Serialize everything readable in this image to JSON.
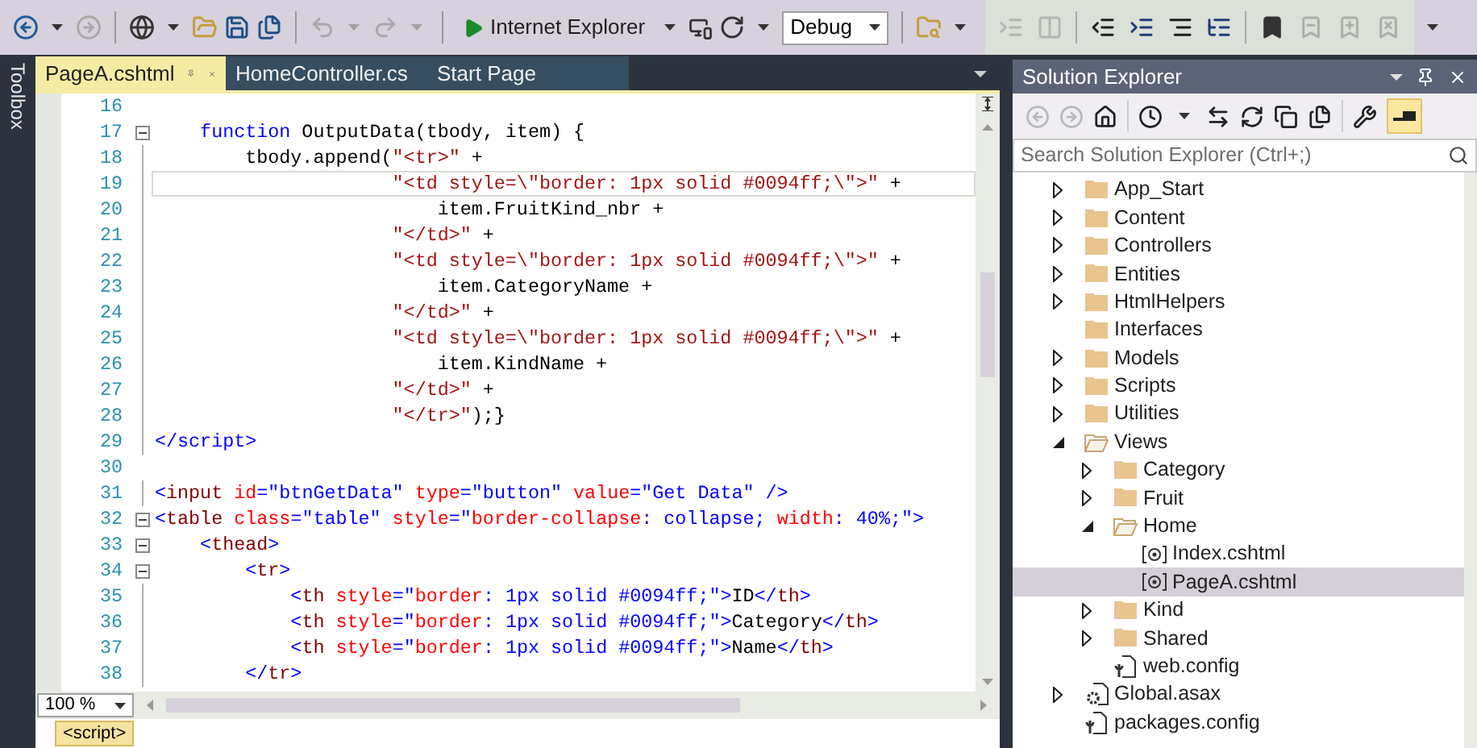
{
  "toolbar": {
    "browser": "Internet Explorer",
    "configuration": "Debug"
  },
  "side_tab": "Toolbox",
  "tabs": [
    {
      "label": "PageA.cshtml",
      "selected": true
    },
    {
      "label": "HomeController.cs",
      "selected": false
    },
    {
      "label": "Start Page",
      "selected": false
    }
  ],
  "code_lines": [
    {
      "number": "16",
      "fold": false,
      "current": false
    },
    {
      "number": "17",
      "fold": true,
      "current": false,
      "tokens": [
        {
          "kind": "keyword",
          "text": "    function"
        },
        {
          "kind": "plain",
          "text": " OutputData(tbody, item) {"
        }
      ]
    },
    {
      "number": "18",
      "fold": false,
      "current": false,
      "tokens": [
        {
          "kind": "plain",
          "text": "        tbody.append("
        },
        {
          "kind": "string",
          "text": "\"<tr>\""
        },
        {
          "kind": "plain",
          "text": " +"
        }
      ]
    },
    {
      "number": "19",
      "fold": false,
      "current": true,
      "tokens": [
        {
          "kind": "string",
          "text": "                     \"<td style=\\\"border: 1px solid #0094ff;\\\">\""
        },
        {
          "kind": "plain",
          "text": " +"
        }
      ]
    },
    {
      "number": "20",
      "fold": false,
      "current": false,
      "tokens": [
        {
          "kind": "plain",
          "text": "                         item.FruitKind_nbr +"
        }
      ]
    },
    {
      "number": "21",
      "fold": false,
      "current": false,
      "tokens": [
        {
          "kind": "string",
          "text": "                     \"</td>\""
        },
        {
          "kind": "plain",
          "text": " +"
        }
      ]
    },
    {
      "number": "22",
      "fold": false,
      "current": false,
      "tokens": [
        {
          "kind": "string",
          "text": "                     \"<td style=\\\"border: 1px solid #0094ff;\\\">\""
        },
        {
          "kind": "plain",
          "text": " +"
        }
      ]
    },
    {
      "number": "23",
      "fold": false,
      "current": false,
      "tokens": [
        {
          "kind": "plain",
          "text": "                         item.CategoryName +"
        }
      ]
    },
    {
      "number": "24",
      "fold": false,
      "current": false,
      "tokens": [
        {
          "kind": "string",
          "text": "                     \"</td>\""
        },
        {
          "kind": "plain",
          "text": " +"
        }
      ]
    },
    {
      "number": "25",
      "fold": false,
      "current": false,
      "tokens": [
        {
          "kind": "string",
          "text": "                     \"<td style=\\\"border: 1px solid #0094ff;\\\">\""
        },
        {
          "kind": "plain",
          "text": " +"
        }
      ]
    },
    {
      "number": "26",
      "fold": false,
      "current": false,
      "tokens": [
        {
          "kind": "plain",
          "text": "                         item.KindName +"
        }
      ]
    },
    {
      "number": "27",
      "fold": false,
      "current": false,
      "tokens": [
        {
          "kind": "string",
          "text": "                     \"</td>\""
        },
        {
          "kind": "plain",
          "text": " +"
        }
      ]
    },
    {
      "number": "28",
      "fold": false,
      "current": false,
      "tokens": [
        {
          "kind": "string",
          "text": "                     \"</tr>\""
        },
        {
          "kind": "plain",
          "text": ");}"
        }
      ]
    },
    {
      "number": "29",
      "fold": false,
      "current": false,
      "tokens": [
        {
          "kind": "delim",
          "text": "</"
        },
        {
          "kind": "delim",
          "text": "script"
        },
        {
          "kind": "delim",
          "text": ">"
        }
      ]
    },
    {
      "number": "30",
      "fold": false,
      "current": false
    },
    {
      "number": "31",
      "fold": false,
      "current": false,
      "tokens": [
        {
          "kind": "delim",
          "text": "<"
        },
        {
          "kind": "element",
          "text": "input"
        },
        {
          "kind": "attr",
          "text": " id"
        },
        {
          "kind": "value",
          "text": "=\"btnGetData\""
        },
        {
          "kind": "attr",
          "text": " type"
        },
        {
          "kind": "value",
          "text": "=\"button\""
        },
        {
          "kind": "attr",
          "text": " value"
        },
        {
          "kind": "value",
          "text": "=\"Get Data\" />"
        }
      ]
    },
    {
      "number": "32",
      "fold": true,
      "current": false,
      "tokens": [
        {
          "kind": "delim",
          "text": "<"
        },
        {
          "kind": "element",
          "text": "table"
        },
        {
          "kind": "attr",
          "text": " class"
        },
        {
          "kind": "value",
          "text": "=\"table\""
        },
        {
          "kind": "attr",
          "text": " style"
        },
        {
          "kind": "value",
          "text": "=\""
        },
        {
          "kind": "attr",
          "text": "border-collapse"
        },
        {
          "kind": "value",
          "text": ": collapse; "
        },
        {
          "kind": "attr",
          "text": "width"
        },
        {
          "kind": "value",
          "text": ": 40%;\">"
        }
      ]
    },
    {
      "number": "33",
      "fold": true,
      "current": false,
      "tokens": [
        {
          "kind": "delim",
          "text": "    <"
        },
        {
          "kind": "element",
          "text": "thead"
        },
        {
          "kind": "delim",
          "text": ">"
        }
      ]
    },
    {
      "number": "34",
      "fold": true,
      "current": false,
      "tokens": [
        {
          "kind": "delim",
          "text": "        <"
        },
        {
          "kind": "element",
          "text": "tr"
        },
        {
          "kind": "delim",
          "text": ">"
        }
      ]
    },
    {
      "number": "35",
      "fold": false,
      "current": false,
      "tokens": [
        {
          "kind": "delim",
          "text": "            <"
        },
        {
          "kind": "element",
          "text": "th"
        },
        {
          "kind": "attr",
          "text": " style"
        },
        {
          "kind": "value",
          "text": "=\""
        },
        {
          "kind": "attr",
          "text": "border"
        },
        {
          "kind": "value",
          "text": ": 1px solid #0094ff;\">"
        },
        {
          "kind": "plain",
          "text": "ID"
        },
        {
          "kind": "delim",
          "text": "</"
        },
        {
          "kind": "element",
          "text": "th"
        },
        {
          "kind": "delim",
          "text": ">"
        }
      ]
    },
    {
      "number": "36",
      "fold": false,
      "current": false,
      "tokens": [
        {
          "kind": "delim",
          "text": "            <"
        },
        {
          "kind": "element",
          "text": "th"
        },
        {
          "kind": "attr",
          "text": " style"
        },
        {
          "kind": "value",
          "text": "=\""
        },
        {
          "kind": "attr",
          "text": "border"
        },
        {
          "kind": "value",
          "text": ": 1px solid #0094ff;\">"
        },
        {
          "kind": "plain",
          "text": "Category"
        },
        {
          "kind": "delim",
          "text": "</"
        },
        {
          "kind": "element",
          "text": "th"
        },
        {
          "kind": "delim",
          "text": ">"
        }
      ]
    },
    {
      "number": "37",
      "fold": false,
      "current": false,
      "tokens": [
        {
          "kind": "delim",
          "text": "            <"
        },
        {
          "kind": "element",
          "text": "th"
        },
        {
          "kind": "attr",
          "text": " style"
        },
        {
          "kind": "value",
          "text": "=\""
        },
        {
          "kind": "attr",
          "text": "border"
        },
        {
          "kind": "value",
          "text": ": 1px solid #0094ff;\">"
        },
        {
          "kind": "plain",
          "text": "Name"
        },
        {
          "kind": "delim",
          "text": "</"
        },
        {
          "kind": "element",
          "text": "th"
        },
        {
          "kind": "delim",
          "text": ">"
        }
      ]
    },
    {
      "number": "38",
      "fold": false,
      "current": false,
      "tokens": [
        {
          "kind": "delim",
          "text": "        </"
        },
        {
          "kind": "element",
          "text": "tr"
        },
        {
          "kind": "delim",
          "text": ">"
        }
      ]
    }
  ],
  "zoom": "100 %",
  "breadcrumb": "<script>",
  "solution_explorer": {
    "title": "Solution Explorer",
    "search": {
      "placeholder": "Search Solution Explorer (Ctrl+;)"
    },
    "tree": [
      {
        "name": "App_Start",
        "kind": "folder",
        "expanded": false,
        "selected": false
      },
      {
        "name": "Content",
        "kind": "folder",
        "expanded": false,
        "selected": false
      },
      {
        "name": "Controllers",
        "kind": "folder",
        "expanded": false,
        "selected": false
      },
      {
        "name": "Entities",
        "kind": "folder",
        "expanded": false,
        "selected": false
      },
      {
        "name": "HtmlHelpers",
        "kind": "folder",
        "expanded": false,
        "selected": false
      },
      {
        "name": "Interfaces",
        "kind": "folder",
        "selected": false
      },
      {
        "name": "Models",
        "kind": "folder",
        "expanded": false,
        "selected": false
      },
      {
        "name": "Scripts",
        "kind": "folder",
        "expanded": false,
        "selected": false
      },
      {
        "name": "Utilities",
        "kind": "folder",
        "expanded": false,
        "selected": false
      },
      {
        "name": "Views",
        "kind": "folder",
        "expanded": true,
        "selected": false,
        "children": [
          {
            "name": "Category",
            "kind": "folder",
            "expanded": false,
            "selected": false
          },
          {
            "name": "Fruit",
            "kind": "folder",
            "expanded": false,
            "selected": false
          },
          {
            "name": "Home",
            "kind": "folder",
            "expanded": true,
            "selected": false,
            "children": [
              {
                "name": "Index.cshtml",
                "kind": "razor",
                "selected": false
              },
              {
                "name": "PageA.cshtml",
                "kind": "razor",
                "selected": true
              }
            ]
          },
          {
            "name": "Kind",
            "kind": "folder",
            "expanded": false,
            "selected": false
          },
          {
            "name": "Shared",
            "kind": "folder",
            "expanded": false,
            "selected": false
          },
          {
            "name": "web.config",
            "kind": "config",
            "selected": false
          }
        ]
      },
      {
        "name": "Global.asax",
        "kind": "asax",
        "expanded": false,
        "selected": false
      },
      {
        "name": "packages.config",
        "kind": "config",
        "selected": false
      }
    ]
  }
}
